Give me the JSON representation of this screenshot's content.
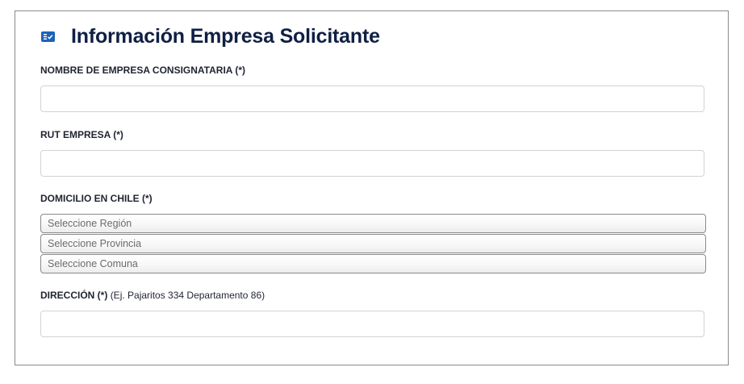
{
  "section": {
    "title": "Información Empresa Solicitante",
    "icon": "form-checklist-icon"
  },
  "fields": {
    "company_name": {
      "label": "NOMBRE DE EMPRESA CONSIGNATARIA (*)",
      "value": ""
    },
    "rut": {
      "label": "RUT EMPRESA (*)",
      "value": ""
    },
    "domicile": {
      "label": "DOMICILIO EN CHILE (*)",
      "region": "Seleccione Región",
      "province": "Seleccione Provincia",
      "commune": "Seleccione Comuna"
    },
    "address": {
      "label": "DIRECCIÓN (*)",
      "hint": "(Ej. Pajaritos 334 Departamento 86)",
      "value": ""
    }
  },
  "colors": {
    "accent": "#1f63b8",
    "title": "#0f1f44",
    "border": "#cfd3d8"
  }
}
